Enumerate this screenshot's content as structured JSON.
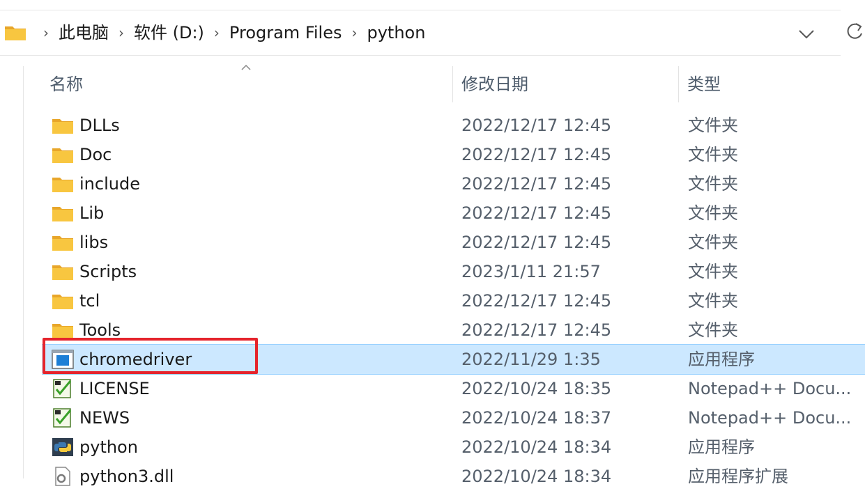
{
  "breadcrumb": {
    "items": [
      "此电脑",
      "软件 (D:)",
      "Program Files",
      "python"
    ],
    "separator": "›"
  },
  "columns": {
    "name": "名称",
    "date": "修改日期",
    "type": "类型"
  },
  "files": [
    {
      "name": "DLLs",
      "date": "2022/12/17 12:45",
      "type": "文件夹",
      "icon": "folder-icon"
    },
    {
      "name": "Doc",
      "date": "2022/12/17 12:45",
      "type": "文件夹",
      "icon": "folder-icon"
    },
    {
      "name": "include",
      "date": "2022/12/17 12:45",
      "type": "文件夹",
      "icon": "folder-icon"
    },
    {
      "name": "Lib",
      "date": "2022/12/17 12:45",
      "type": "文件夹",
      "icon": "folder-icon"
    },
    {
      "name": "libs",
      "date": "2022/12/17 12:45",
      "type": "文件夹",
      "icon": "folder-icon"
    },
    {
      "name": "Scripts",
      "date": "2023/1/11 21:57",
      "type": "文件夹",
      "icon": "folder-icon"
    },
    {
      "name": "tcl",
      "date": "2022/12/17 12:45",
      "type": "文件夹",
      "icon": "folder-icon"
    },
    {
      "name": "Tools",
      "date": "2022/12/17 12:45",
      "type": "文件夹",
      "icon": "folder-icon"
    },
    {
      "name": "chromedriver",
      "date": "2022/11/29 1:35",
      "type": "应用程序",
      "icon": "application-icon",
      "selected": true
    },
    {
      "name": "LICENSE",
      "date": "2022/10/24 18:35",
      "type": "Notepad++ Docu...",
      "icon": "notepadpp-document-icon"
    },
    {
      "name": "NEWS",
      "date": "2022/10/24 18:37",
      "type": "Notepad++ Docu...",
      "icon": "notepadpp-document-icon"
    },
    {
      "name": "python",
      "date": "2022/10/24 18:34",
      "type": "应用程序",
      "icon": "python-icon"
    },
    {
      "name": "python3.dll",
      "date": "2022/10/24 18:34",
      "type": "应用程序扩展",
      "icon": "dll-icon"
    }
  ],
  "colors": {
    "selection_bg": "#cce8ff",
    "selection_border": "#99d1ff",
    "highlight_box": "#e5242c",
    "folder_yellow": "#f8c640"
  }
}
